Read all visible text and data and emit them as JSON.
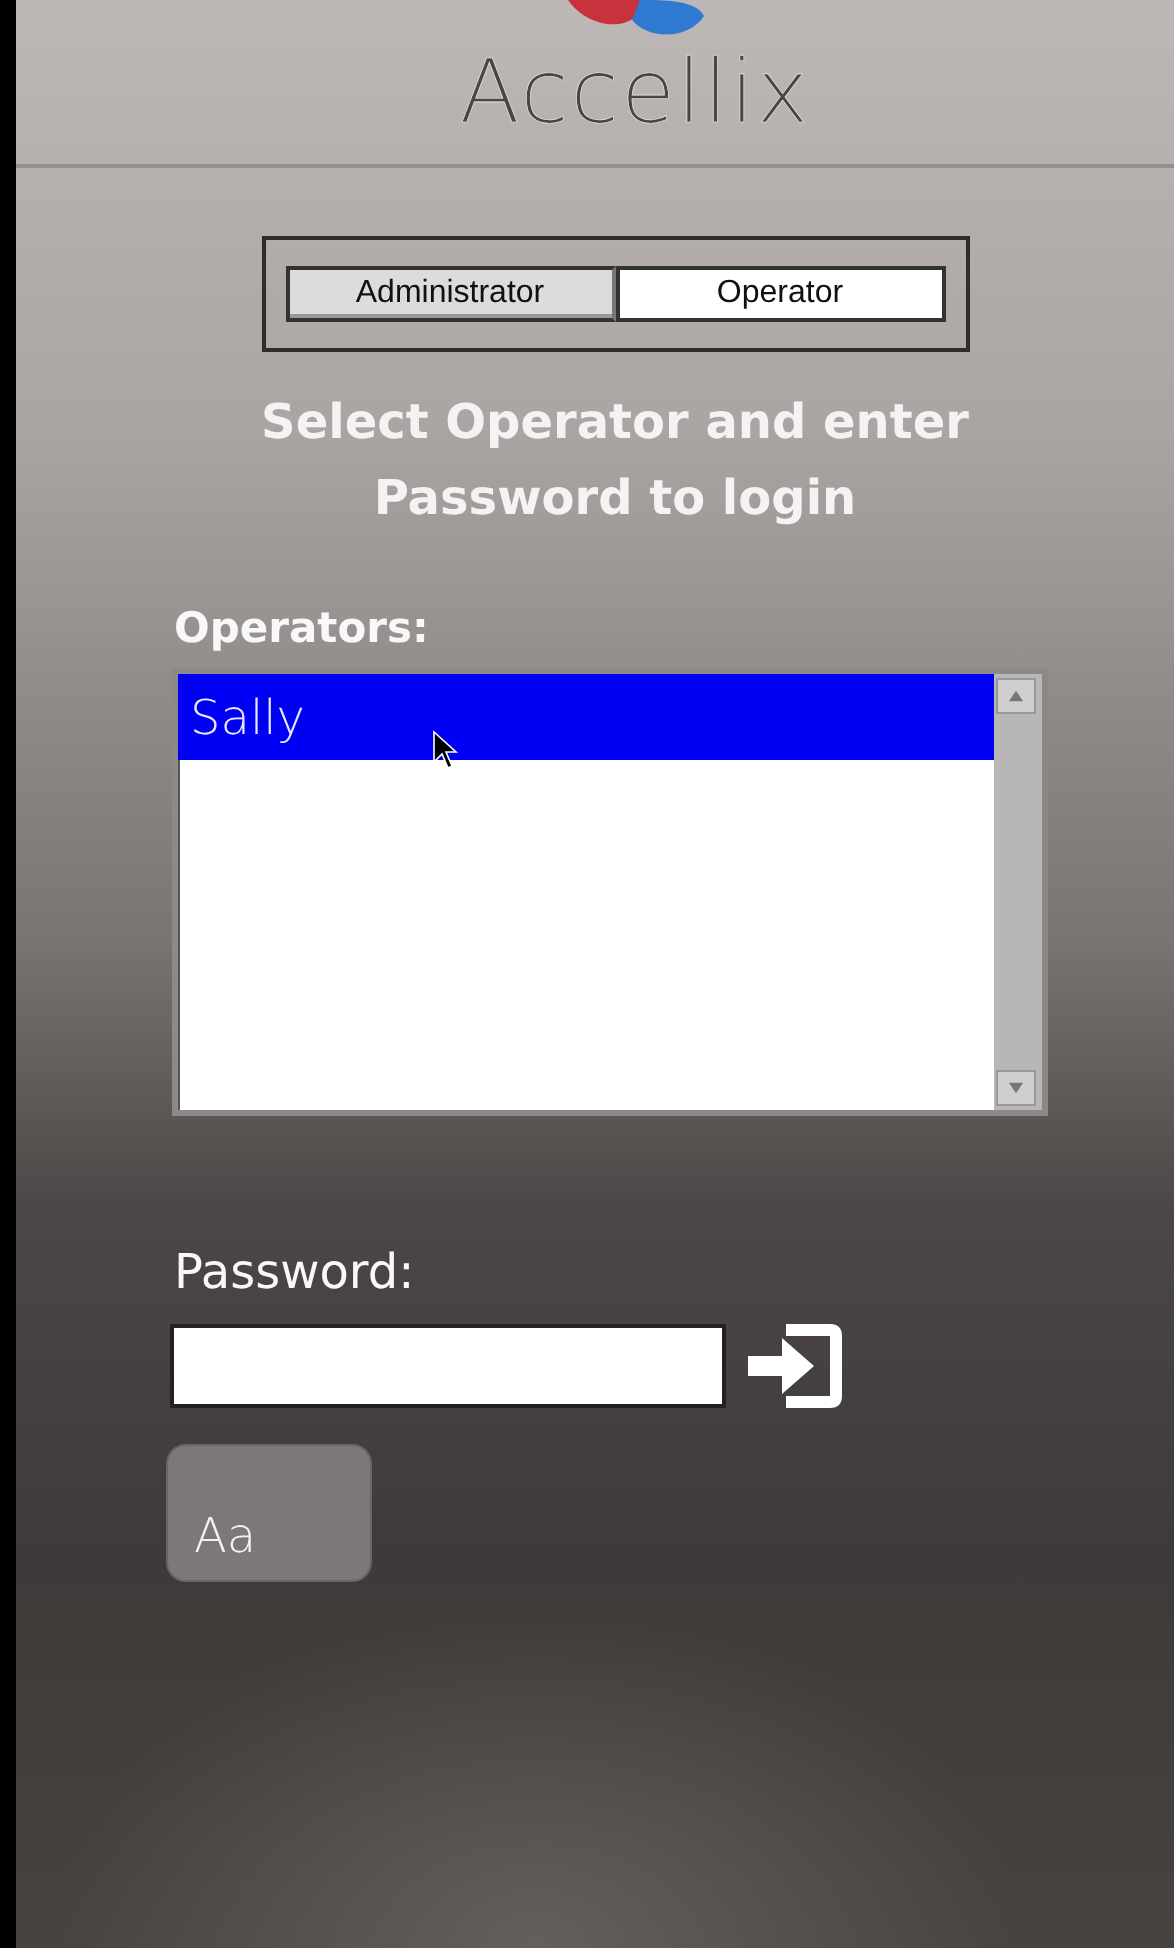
{
  "logo": {
    "text": "Accellix"
  },
  "role_toggle": [
    {
      "label": "Administrator",
      "selected": false
    },
    {
      "label": "Operator",
      "selected": true
    }
  ],
  "instruction": "Select Operator and enter Password to login",
  "operators": {
    "label": "Operators:",
    "items": [
      {
        "name": "Sally",
        "selected": true
      }
    ]
  },
  "password": {
    "label": "Password:"
  },
  "keyboard_button": {
    "label": "Aa"
  }
}
